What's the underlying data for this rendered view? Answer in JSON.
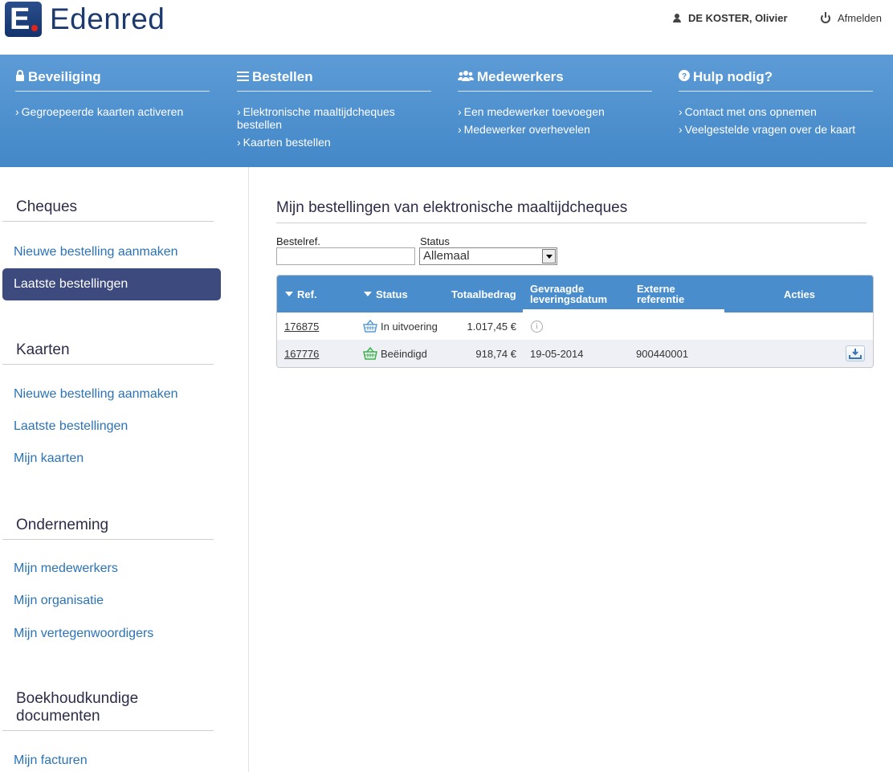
{
  "brand": {
    "name": "Edenred",
    "mark": "E"
  },
  "user": {
    "name": "DE KOSTER, Olivier",
    "logout": "Afmelden"
  },
  "nav": [
    {
      "title": "Beveiliging",
      "icon": "lock-icon",
      "links": [
        "Gegroepeerde kaarten activeren"
      ]
    },
    {
      "title": "Bestellen",
      "icon": "list-icon",
      "links": [
        "Elektronische maaltijdcheques bestellen",
        "Kaarten bestellen"
      ]
    },
    {
      "title": "Medewerkers",
      "icon": "users-icon",
      "links": [
        "Een medewerker toevoegen",
        "Medewerker overhevelen"
      ]
    },
    {
      "title": "Hulp nodig?",
      "icon": "question-icon",
      "links": [
        "Contact met ons opnemen",
        "Veelgestelde vragen over de kaart"
      ]
    }
  ],
  "sidebar": {
    "cheques": {
      "title": "Cheques",
      "links": [
        "Nieuwe bestelling aanmaken",
        "Laatste bestellingen"
      ]
    },
    "kaarten": {
      "title": "Kaarten",
      "links": [
        "Nieuwe bestelling aanmaken",
        "Laatste bestellingen",
        "Mijn kaarten"
      ]
    },
    "onderneming": {
      "title": "Onderneming",
      "links": [
        "Mijn medewerkers",
        "Mijn organisatie",
        "Mijn vertegenwoordigers"
      ]
    },
    "boekhouding": {
      "title_line1": "Boekhoudkundige",
      "title_line2": "documenten",
      "links": [
        "Mijn facturen"
      ]
    }
  },
  "main": {
    "title": "Mijn bestellingen van elektronische maaltijdcheques",
    "filter": {
      "ref_label": "Bestelref.",
      "ref_value": "",
      "status_label": "Status",
      "status_value": "Allemaal"
    },
    "table": {
      "headers": {
        "ref": "Ref.",
        "status": "Status",
        "amount": "Totaalbedrag",
        "date_line1": "Gevraagde",
        "date_line2": "leveringsdatum",
        "extref_line1": "Externe",
        "extref_line2": "referentie",
        "actions": "Acties"
      },
      "rows": [
        {
          "ref": "176875",
          "status": "In uitvoering",
          "status_color": "#5b9bd5",
          "amount": "1.017,45 €",
          "date": "",
          "extref": ""
        },
        {
          "ref": "167776",
          "status": "Beëindigd",
          "status_color": "#3bb34a",
          "amount": "918,74 €",
          "date": "19-05-2014",
          "extref": "900440001"
        }
      ]
    }
  }
}
